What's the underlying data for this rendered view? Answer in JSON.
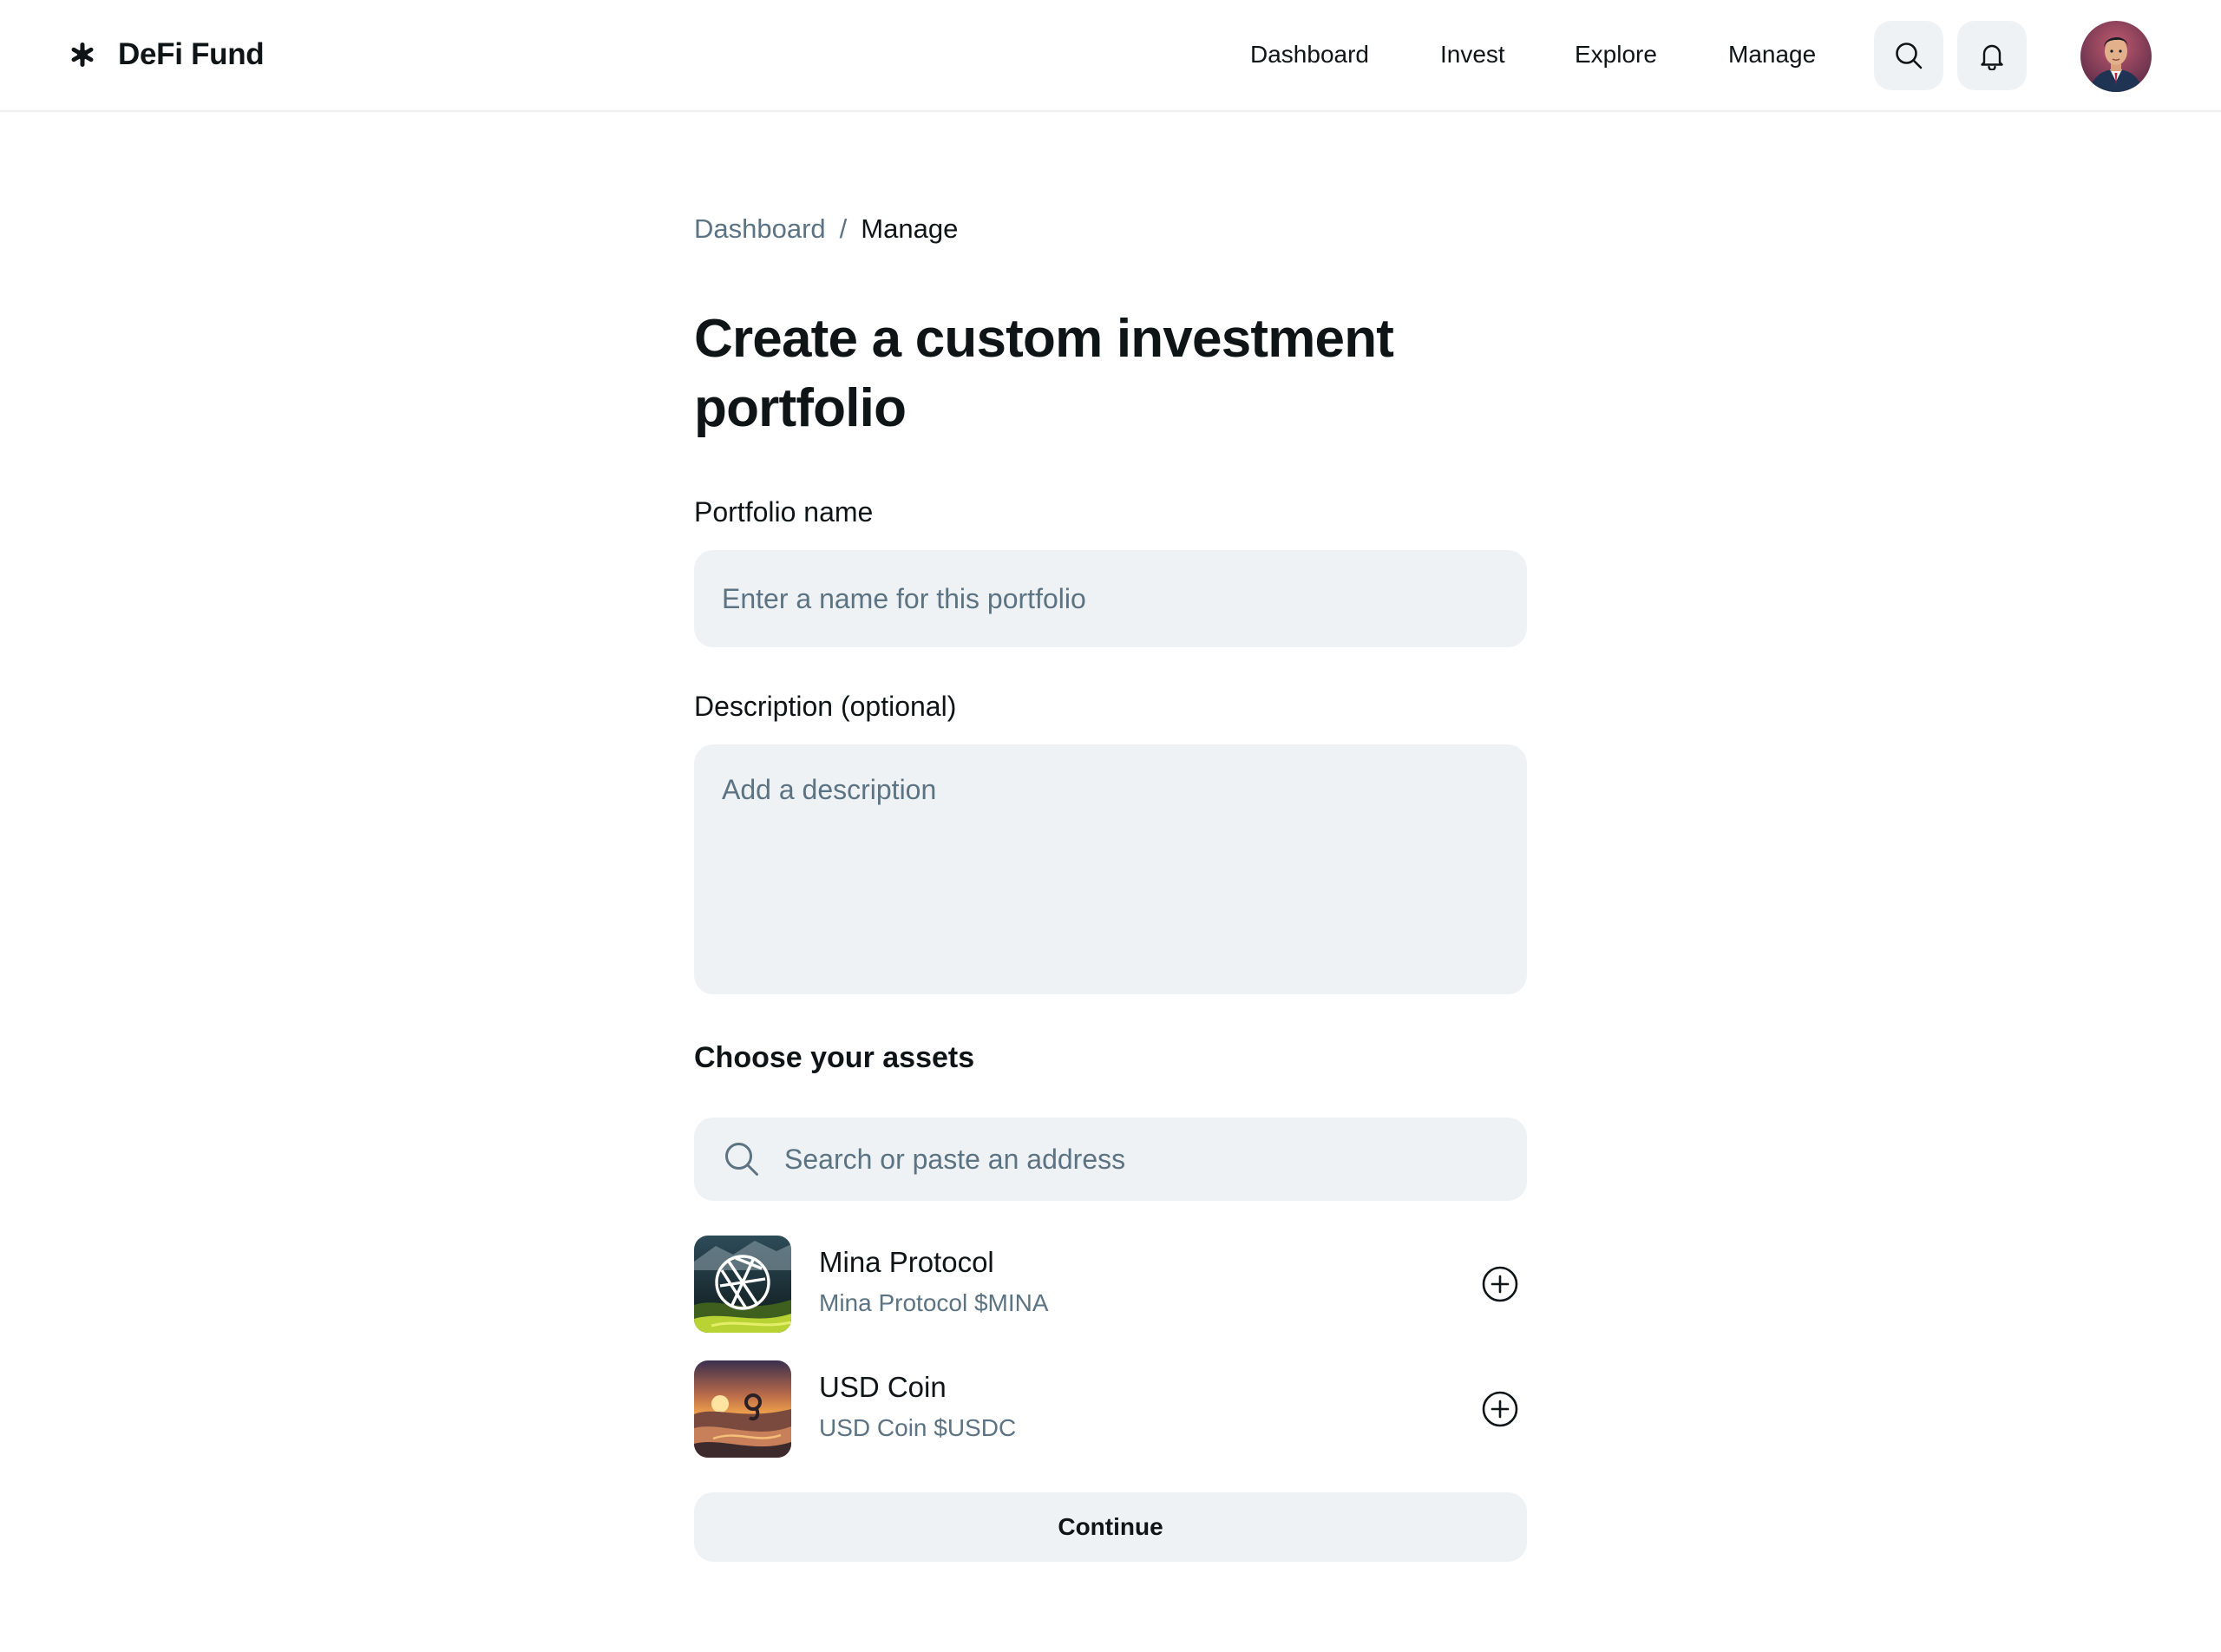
{
  "header": {
    "brand_name": "DeFi Fund",
    "logo_icon": "asterisk-logo-icon",
    "nav": [
      {
        "label": "Dashboard"
      },
      {
        "label": "Invest"
      },
      {
        "label": "Explore"
      },
      {
        "label": "Manage"
      }
    ],
    "search_icon": "search-icon",
    "notifications_icon": "bell-icon"
  },
  "breadcrumb": {
    "items": [
      "Dashboard",
      "Manage"
    ],
    "separator": "/"
  },
  "page_title": "Create a custom investment portfolio",
  "form": {
    "portfolio_name_label": "Portfolio name",
    "portfolio_name_placeholder": "Enter a name for this portfolio",
    "portfolio_name_value": "",
    "description_label": "Description (optional)",
    "description_placeholder": "Add a description",
    "description_value": ""
  },
  "assets_section": {
    "title": "Choose your assets",
    "search_placeholder": "Search or paste an address",
    "items": [
      {
        "name": "Mina Protocol",
        "subtitle": "Mina Protocol $MINA",
        "add_icon": "plus-circle-icon"
      },
      {
        "name": "USD Coin",
        "subtitle": "USD Coin $USDC",
        "add_icon": "plus-circle-icon"
      }
    ]
  },
  "continue_label": "Continue",
  "colors": {
    "text_primary": "#0f1417",
    "text_secondary": "#5b7382",
    "field_background": "#eff2f4",
    "border": "#eef0f2"
  }
}
